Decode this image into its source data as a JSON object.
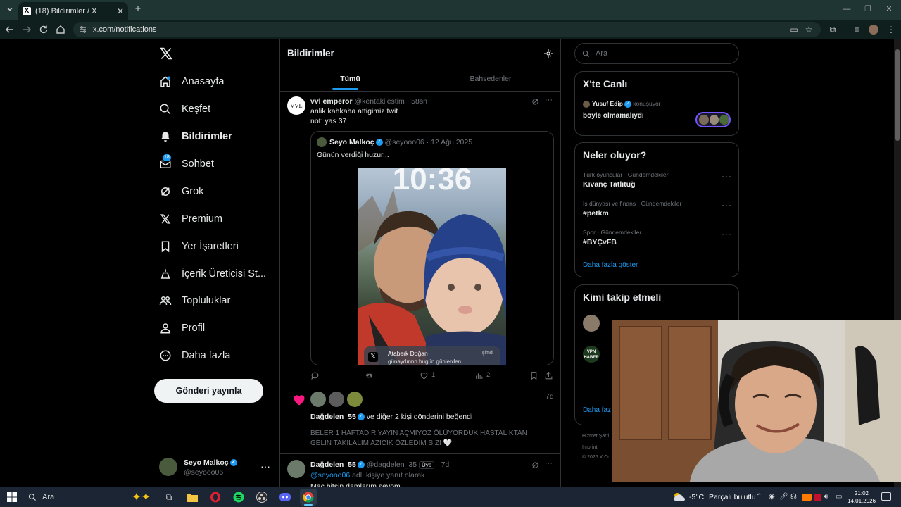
{
  "browser": {
    "tab_title": "(18) Bildirimler / X",
    "tab_favicon": "X",
    "url": "x.com/notifications"
  },
  "sidebar": {
    "items": [
      {
        "label": "Anasayfa",
        "icon": "home-icon"
      },
      {
        "label": "Keşfet",
        "icon": "search-icon"
      },
      {
        "label": "Bildirimler",
        "icon": "bell-icon",
        "active": true
      },
      {
        "label": "Sohbet",
        "icon": "mail-icon",
        "badge": "18"
      },
      {
        "label": "Grok",
        "icon": "grok-icon"
      },
      {
        "label": "Premium",
        "icon": "x-logo-icon"
      },
      {
        "label": "Yer İşaretleri",
        "icon": "bookmark-icon"
      },
      {
        "label": "İçerik Üreticisi St...",
        "icon": "creator-icon"
      },
      {
        "label": "Topluluklar",
        "icon": "people-icon"
      },
      {
        "label": "Profil",
        "icon": "person-icon"
      },
      {
        "label": "Daha fazla",
        "icon": "more-circle-icon"
      }
    ],
    "post_button": "Gönderi yayınla",
    "account": {
      "name": "Seyo Malkoç",
      "handle": "@seyooo06"
    }
  },
  "center": {
    "title": "Bildirimler",
    "tabs": [
      "Tümü",
      "Bahsedenler"
    ],
    "tweet1": {
      "avatar_text": "VVL",
      "name": "vvl emperor",
      "handle": "@kentakilestim",
      "time": "· 58sn",
      "lines": [
        "anlik kahkaha attigimiz twit",
        "not: yas 37"
      ],
      "quote": {
        "name": "Seyo Malkoç",
        "handle": "@seyooo06",
        "date": "· 12 Ağu 2025",
        "text": "Günün verdiği huzur...",
        "clock": "10:36",
        "notif_name": "Ataberk Doğan",
        "notif_text": "günaydınnn bugün günlerden",
        "notif_time": "şimdi"
      },
      "likes": "1",
      "views": "2"
    },
    "like_notif": {
      "time": "7d",
      "name": "Dağdelen_55",
      "text": "ve diğer 2 kişi gönderini beğendi",
      "quoted": "BELER 1 HAFTADIR YAYIN AÇMIYOZ ÖLÜYORDUK HASTALIKTAN GELİN TAKILALIM AZICIK ÖZLEDİM SİZİ 🤍"
    },
    "reply": {
      "name": "Dağdelen_55",
      "handle": "@dagdelen_35",
      "member_badge": "Üye",
      "time": "· 7d",
      "mention": "@seyooo06",
      "mention_suffix": "adlı kişiye yanıt olarak",
      "text": "Maç bitsin damlarım sevom"
    }
  },
  "right": {
    "search_placeholder": "Ara",
    "live": {
      "title": "X'te Canlı",
      "host": "Yusuf Edip",
      "status": "konuşuyor",
      "topic": "böyle olmamalıydı"
    },
    "trends": {
      "title": "Neler oluyor?",
      "items": [
        {
          "category": "Türk oyuncular · Gündemdekiler",
          "name": "Kıvanç Tatlıtuğ"
        },
        {
          "category": "İş dünyası ve finans · Gündemdekiler",
          "name": "#petkm"
        },
        {
          "category": "Spor · Gündemdekiler",
          "name": "#BYÇvFB"
        }
      ],
      "show_more": "Daha fazla göster"
    },
    "follow": {
      "title": "Kimi takip etmeli",
      "show_more": "Daha faz",
      "vpn_badge": "VPN HABER"
    },
    "footer": {
      "line1": "Hizmet Şartl",
      "imprint": "Imprint",
      "copyright": "© 2026 X Co"
    }
  },
  "taskbar": {
    "search": "Ara",
    "weather_temp": "-5°C",
    "weather_text": "Parçalı bulutlu",
    "time": "21:02",
    "date": "14.01.2026"
  },
  "colors": {
    "accent": "#1d9bf0",
    "like": "#f91880",
    "tab_bar": "#1f3533",
    "toolbar": "#0f1f1e",
    "taskbar": "#1c2533"
  }
}
